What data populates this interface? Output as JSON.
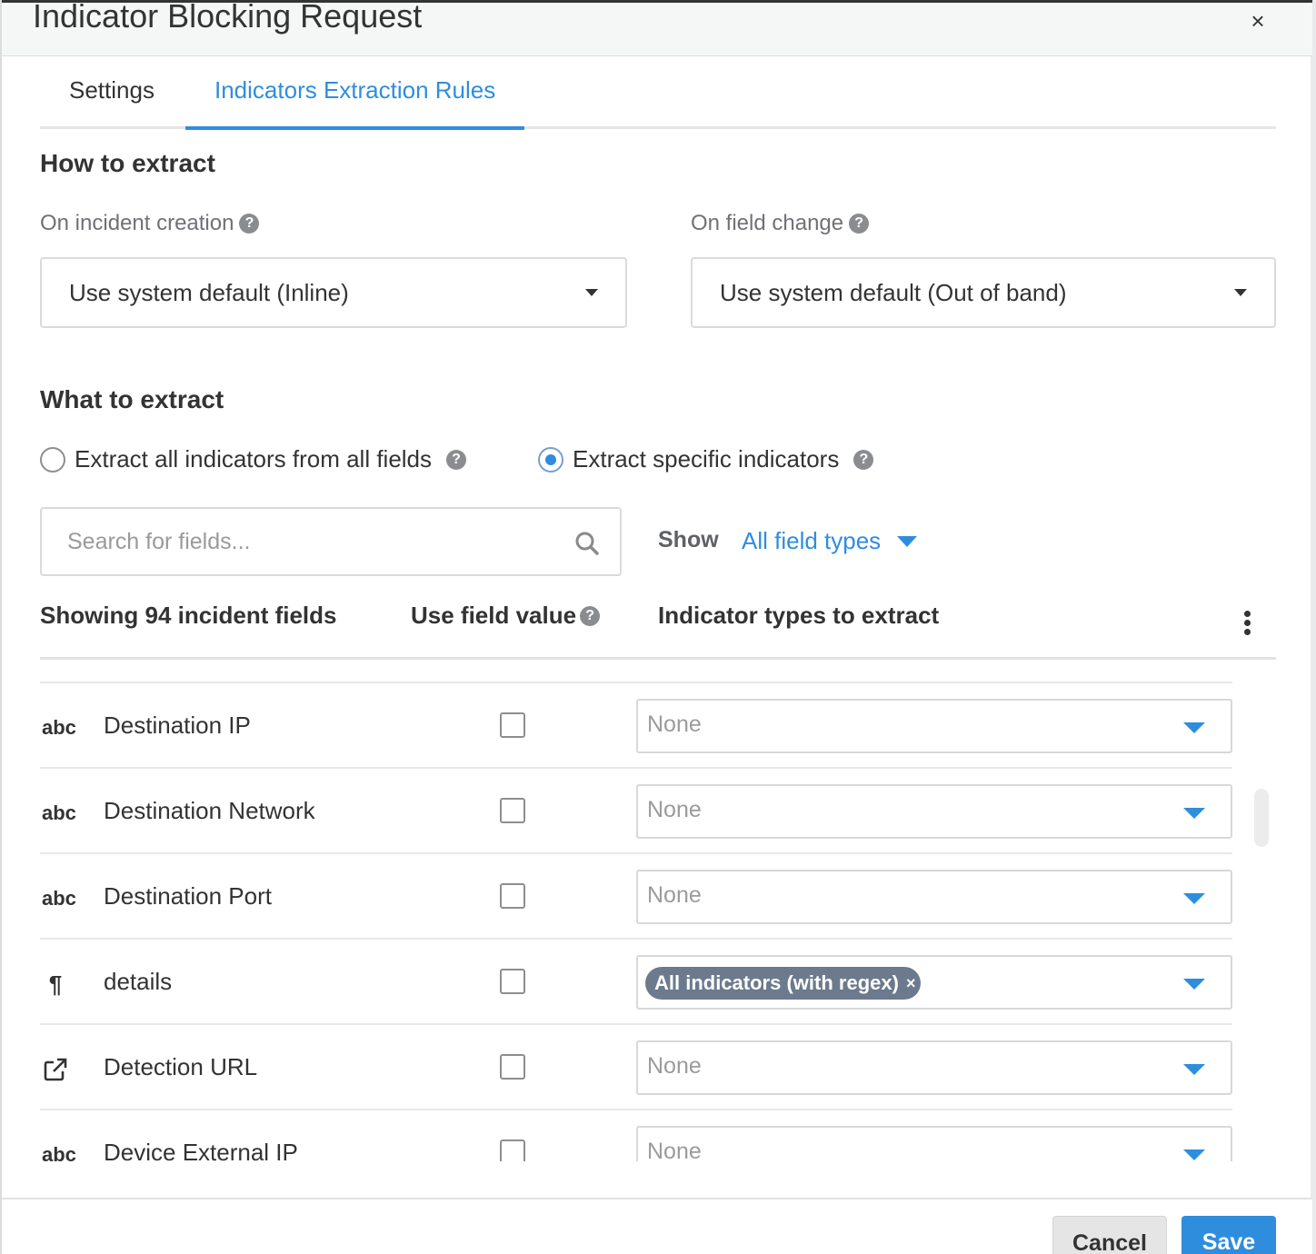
{
  "dialog": {
    "title": "Indicator Blocking Request",
    "close_symbol": "×"
  },
  "tabs": [
    {
      "label": "Settings",
      "active": false
    },
    {
      "label": "Indicators Extraction Rules",
      "active": true
    }
  ],
  "how_to_extract": {
    "heading": "How to extract",
    "on_incident_creation": {
      "label": "On incident creation",
      "value": "Use system default (Inline)"
    },
    "on_field_change": {
      "label": "On field change",
      "value": "Use system default (Out of band)"
    }
  },
  "what_to_extract": {
    "heading": "What to extract",
    "options": [
      {
        "label": "Extract all indicators from all fields",
        "selected": false
      },
      {
        "label": "Extract specific indicators",
        "selected": true
      }
    ]
  },
  "search": {
    "placeholder": "Search for fields..."
  },
  "filter": {
    "show_label": "Show",
    "value": "All field types"
  },
  "table": {
    "headers": {
      "fields": "Showing 94 incident fields",
      "use_field_value": "Use field value",
      "indicator_types": "Indicator types to extract"
    },
    "rows": [
      {
        "type_icon": "text-field-icon",
        "type_glyph": "abc",
        "name": "Destination IP",
        "use_field_value": false,
        "indicator": "None",
        "chip": null
      },
      {
        "type_icon": "text-field-icon",
        "type_glyph": "abc",
        "name": "Destination Network",
        "use_field_value": false,
        "indicator": "None",
        "chip": null
      },
      {
        "type_icon": "text-field-icon",
        "type_glyph": "abc",
        "name": "Destination Port",
        "use_field_value": false,
        "indicator": "None",
        "chip": null
      },
      {
        "type_icon": "paragraph-icon",
        "type_glyph": "¶",
        "name": "details",
        "use_field_value": false,
        "indicator": "",
        "chip": "All indicators (with regex)"
      },
      {
        "type_icon": "url-field-icon",
        "type_glyph": "↗",
        "name": "Detection URL",
        "use_field_value": false,
        "indicator": "None",
        "chip": null
      },
      {
        "type_icon": "text-field-icon",
        "type_glyph": "abc",
        "name": "Device External IP",
        "use_field_value": false,
        "indicator": "None",
        "chip": null
      }
    ]
  },
  "footer": {
    "cancel_label": "Cancel",
    "save_label": "Save"
  },
  "colors": {
    "accent": "#2f8dde",
    "chip": "#6c7a8d"
  }
}
